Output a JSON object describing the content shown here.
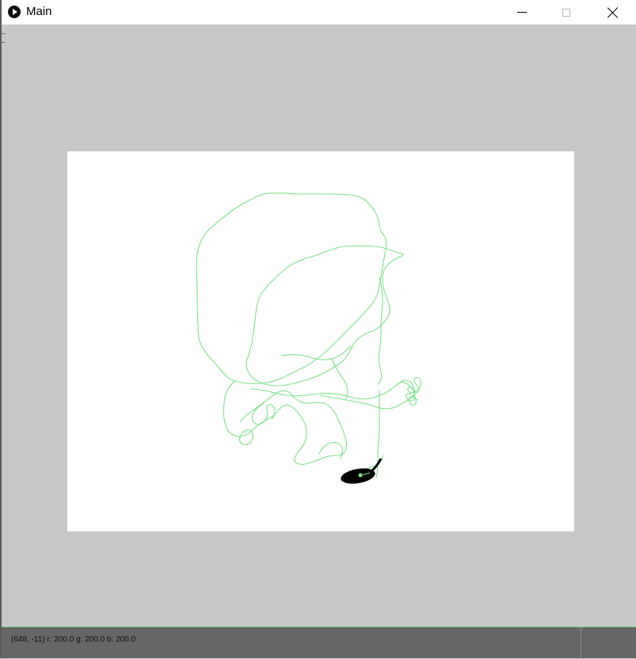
{
  "window": {
    "title": "Main"
  },
  "title_controls": {
    "minimize": "minimize-icon",
    "maximize": "maximize-icon",
    "close": "close-icon"
  },
  "canvas": {
    "background": "#ffffff",
    "trail_color": "#7fe28a",
    "blob_color": "#000000"
  },
  "status": {
    "text": "(648, -11) r: 200.0 g: 200.0 b: 200.0"
  },
  "colors": {
    "frame": "#c8c8c8",
    "status_bar": "#666666",
    "status_border": "#6ecf7a"
  }
}
